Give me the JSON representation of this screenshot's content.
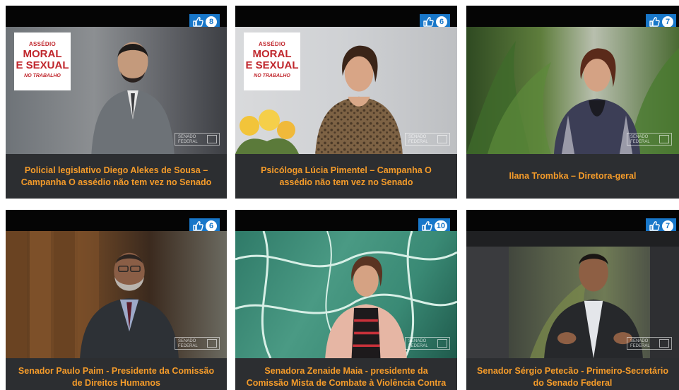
{
  "videos": [
    {
      "likes": "8",
      "caption": "Policial legislativo Diego Alekes de Sousa – Campanha O assédio não tem vez no Senado",
      "campaign_logo": {
        "line1": "ASSÉDIO",
        "line2": "MORAL",
        "line3": "E SEXUAL",
        "line4": "NO TRABALHO"
      },
      "watermark": {
        "line1": "SENADO",
        "line2": "FEDERAL"
      }
    },
    {
      "likes": "6",
      "caption": "Psicóloga Lúcia Pimentel – Campanha O assédio não tem vez no Senado",
      "campaign_logo": {
        "line1": "ASSÉDIO",
        "line2": "MORAL",
        "line3": "E SEXUAL",
        "line4": "NO TRABALHO"
      },
      "watermark": {
        "line1": "SENADO",
        "line2": "FEDERAL"
      }
    },
    {
      "likes": "7",
      "caption": "Ilana Trombka – Diretora-geral",
      "watermark": {
        "line1": "SENADO",
        "line2": "FEDERAL"
      }
    },
    {
      "likes": "6",
      "caption": "Senador Paulo Paim - Presidente da Comissão de Direitos Humanos",
      "watermark": {
        "line1": "SENADO",
        "line2": "FEDERAL"
      }
    },
    {
      "likes": "10",
      "caption": "Senadora Zenaide Maia - presidente da Comissão Mista de Combate à Violência Contra a Mulher",
      "watermark": {
        "line1": "SENADO",
        "line2": "FEDERAL"
      }
    },
    {
      "likes": "7",
      "caption": "Senador Sérgio Petecão - Primeiro-Secretário do Senado Federal",
      "watermark": {
        "line1": "SENADO",
        "line2": "FEDERAL"
      }
    }
  ],
  "icons": {
    "like": "thumbs-up-icon"
  },
  "colors": {
    "caption": "#f49b2a",
    "badge": "#1877c9",
    "card": "#2c2e31",
    "topbar": "#050505"
  }
}
